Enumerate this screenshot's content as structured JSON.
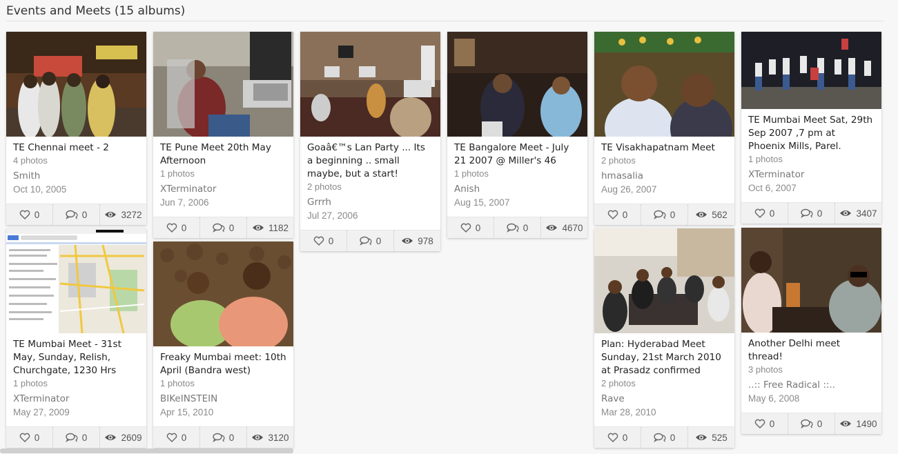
{
  "header": {
    "title": "Events and Meets (15 albums)"
  },
  "albums": [
    {
      "title": "TE Chennai meet - 2",
      "count": "4 photos",
      "author": "Smith",
      "date": "Oct 10, 2005",
      "likes": "0",
      "comments": "0",
      "views": "3272"
    },
    {
      "title": "TE Pune Meet 20th May Afternoon",
      "count": "1 photos",
      "author": "XTerminator",
      "date": "Jun 7, 2006",
      "likes": "0",
      "comments": "0",
      "views": "1182"
    },
    {
      "title": "Goaâ€™s Lan Party ... Its a beginning .. small maybe, but a start!",
      "count": "2 photos",
      "author": "Grrrh",
      "date": "Jul 27, 2006",
      "likes": "0",
      "comments": "0",
      "views": "978"
    },
    {
      "title": "TE Bangalore Meet - July 21 2007 @ Miller's 46",
      "count": "1 photos",
      "author": "Anish",
      "date": "Aug 15, 2007",
      "likes": "0",
      "comments": "0",
      "views": "4670"
    },
    {
      "title": "TE Visakhapatnam Meet",
      "count": "2 photos",
      "author": "hmasalia",
      "date": "Aug 26, 2007",
      "likes": "0",
      "comments": "0",
      "views": "562"
    },
    {
      "title": "TE Mumbai Meet Sat, 29th Sep 2007 ,7 pm at Phoenix Mills, Parel.",
      "count": "1 photos",
      "author": "XTerminator",
      "date": "Oct 6, 2007",
      "likes": "0",
      "comments": "0",
      "views": "3407"
    },
    {
      "title": "TE Mumbai Meet - 31st May, Sunday, Relish, Churchgate, 1230 Hrs",
      "count": "1 photos",
      "author": "XTerminator",
      "date": "May 27, 2009",
      "likes": "0",
      "comments": "0",
      "views": "2609"
    },
    {
      "title": "Freaky Mumbai meet: 10th April (Bandra west)",
      "count": "1 photos",
      "author": "BIKeINSTEIN",
      "date": "Apr 15, 2010",
      "likes": "0",
      "comments": "0",
      "views": "3120"
    },
    {
      "title": "Plan: Hyderabad Meet Sunday, 21st March 2010 at Prasadz confirmed",
      "count": "2 photos",
      "author": "Rave",
      "date": "Mar 28, 2010",
      "likes": "0",
      "comments": "0",
      "views": "525"
    },
    {
      "title": "Another Delhi meet thread!",
      "count": "3 photos",
      "author": "..:: Free Radical ::..",
      "date": "May 6, 2008",
      "likes": "0",
      "comments": "0",
      "views": "1490"
    }
  ],
  "icons": {
    "like": "heart-icon",
    "comment": "comments-icon",
    "view": "eye-icon"
  }
}
